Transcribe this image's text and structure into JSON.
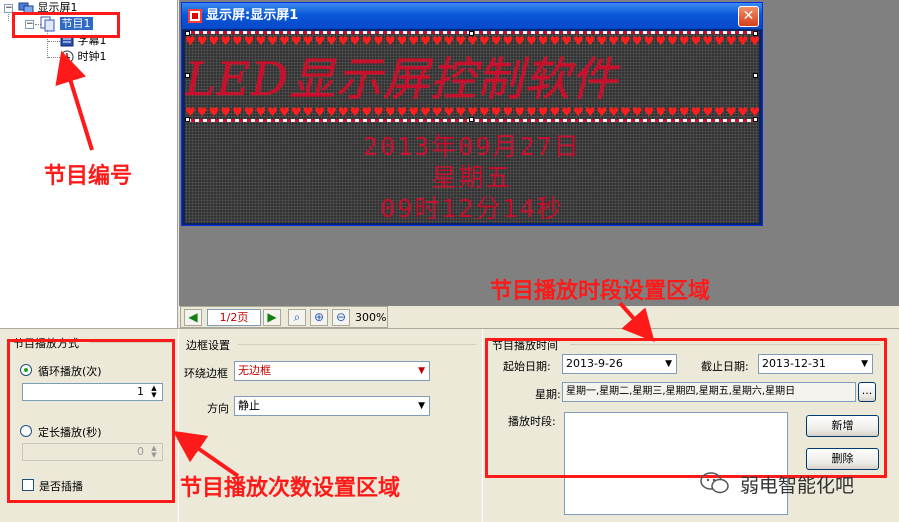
{
  "tree": {
    "root_label": "显示屏1",
    "program_label": "节目1",
    "items": [
      {
        "label": "字幕1",
        "icon": "caption-icon"
      },
      {
        "label": "时钟1",
        "icon": "clock-icon"
      }
    ]
  },
  "preview": {
    "window_title": "显示屏:显示屏1",
    "close_glyph": "✕",
    "caption_text": "LED显示屏控制软件",
    "clock_lines": [
      "2013年09月27日",
      "星期五",
      "09时12分14秒"
    ],
    "led_color": "#c8102e"
  },
  "toolbar": {
    "page": "1/2页",
    "zoom": "300%"
  },
  "play_mode": {
    "title": "节目播放方式",
    "loop_label": "循环播放(次)",
    "loop_value": "1",
    "timed_label": "定长播放(秒)",
    "timed_value": "0",
    "insert_label": "是否插播"
  },
  "border": {
    "title": "边框设置",
    "border_label": "环绕边框",
    "border_value": "无边框",
    "direction_label": "方向",
    "direction_value": "静止"
  },
  "schedule": {
    "title": "节目播放时间",
    "start_label": "起始日期:",
    "start_value": "2013-9-26",
    "end_label": "截止日期:",
    "end_value": "2013-12-31",
    "week_label": "星期:",
    "week_value": "星期一,星期二,星期三,星期四,星期五,星期六,星期日",
    "week_btn": "...",
    "period_label": "播放时段:",
    "add_btn": "新增",
    "delete_btn": "删除"
  },
  "annotations": {
    "program_number": "节目编号",
    "schedule_area": "节目播放时段设置区域",
    "count_area": "节目播放次数设置区域"
  },
  "watermark": "弱电智能化吧",
  "colors": {
    "annotation": "#ff1a1a",
    "selection": "#316ac5"
  }
}
